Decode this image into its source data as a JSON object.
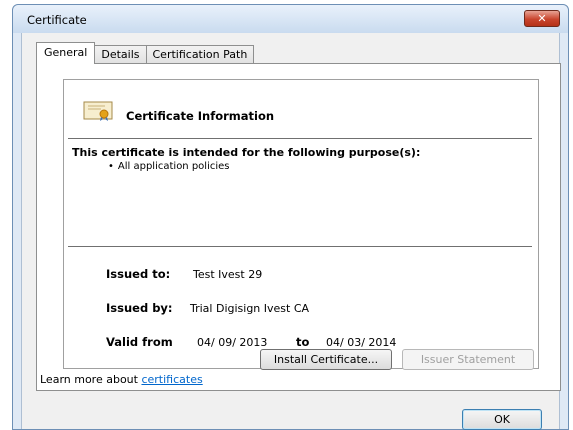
{
  "window": {
    "title": "Certificate"
  },
  "tabs": [
    {
      "label": "General",
      "active": true
    },
    {
      "label": "Details",
      "active": false
    },
    {
      "label": "Certification Path",
      "active": false
    }
  ],
  "certificate": {
    "info_title": "Certificate Information",
    "purpose_heading": "This certificate is intended for the following purpose(s):",
    "purposes": [
      "All application policies"
    ],
    "issued_to_label": "Issued to:",
    "issued_to": "Test Ivest 29",
    "issued_by_label": "Issued by:",
    "issued_by": "Trial Digisign Ivest CA",
    "valid_from_label": "Valid from",
    "valid_from": "04/ 09/ 2013",
    "to_label": "to",
    "valid_to": "04/ 03/ 2014"
  },
  "buttons": {
    "install": "Install Certificate...",
    "issuer_statement": "Issuer Statement",
    "ok": "OK"
  },
  "learn_more": {
    "prefix": "Learn more about",
    "link": "certificates"
  }
}
